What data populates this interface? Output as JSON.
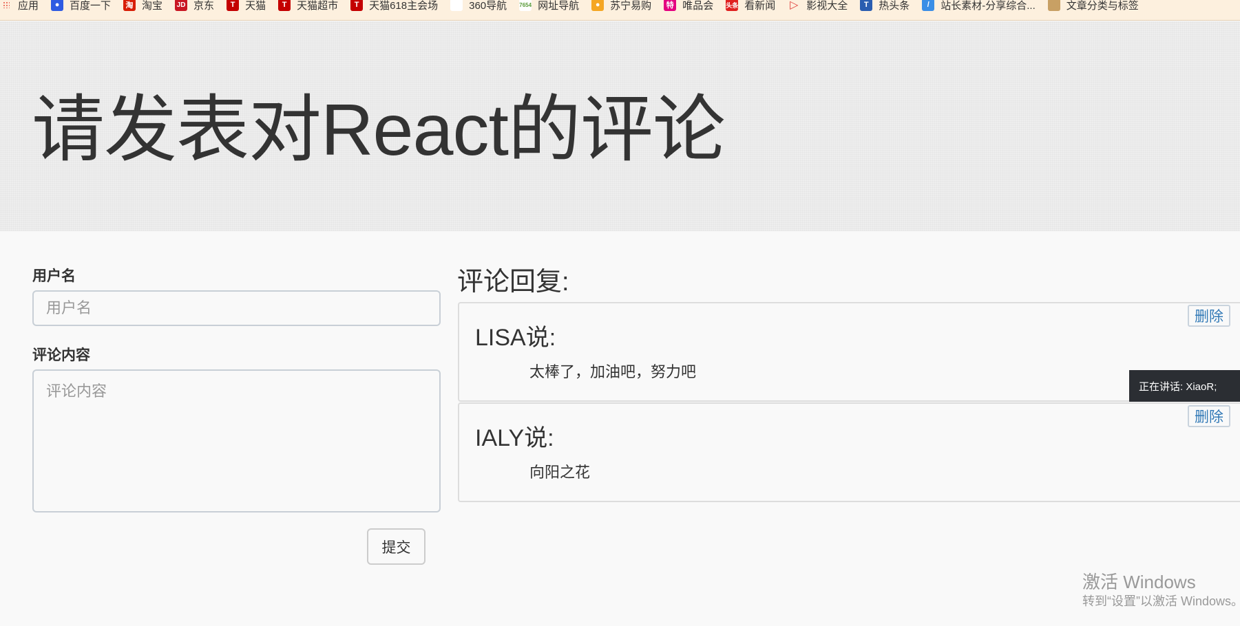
{
  "bookmarks": [
    {
      "label": "应用",
      "icon": "apps-grid-icon",
      "color": "#e74c3c"
    },
    {
      "label": "百度一下",
      "icon": "baidu-paw-icon",
      "color": "#2f5be2"
    },
    {
      "label": "淘宝",
      "icon": "taobao-icon",
      "color": "#d81e06"
    },
    {
      "label": "京东",
      "icon": "jd-icon",
      "color": "#c91623"
    },
    {
      "label": "天猫",
      "icon": "tmall-icon",
      "color": "#c40000"
    },
    {
      "label": "天猫超市",
      "icon": "tmall-market-icon",
      "color": "#c40000"
    },
    {
      "label": "天猫618主会场",
      "icon": "tmall-618-icon",
      "color": "#c40000"
    },
    {
      "label": "360导航",
      "icon": "blank-page-icon",
      "color": "#ffffff"
    },
    {
      "label": "网址导航",
      "icon": "7654-icon",
      "color": "#ffffff"
    },
    {
      "label": "苏宁易购",
      "icon": "suning-icon",
      "color": "#f5a623"
    },
    {
      "label": "唯品会",
      "icon": "vip-icon",
      "color": "#e4007f"
    },
    {
      "label": "看新闻",
      "icon": "toutiao-news-icon",
      "color": "#e02020"
    },
    {
      "label": "影视大全",
      "icon": "play-icon",
      "color": "#e0443f"
    },
    {
      "label": "热头条",
      "icon": "t-headline-icon",
      "color": "#2a5db0"
    },
    {
      "label": "站长素材-分享综合...",
      "icon": "sc-icon",
      "color": "#3a8ee6"
    },
    {
      "label": "文章分类与标签",
      "icon": "folder-icon",
      "color": "#c8a064"
    }
  ],
  "header": {
    "title": "请发表对React的评论"
  },
  "form": {
    "username_label": "用户名",
    "username_placeholder": "用户名",
    "content_label": "评论内容",
    "content_placeholder": "评论内容",
    "submit_label": "提交"
  },
  "comments": {
    "section_title": "评论回复:",
    "items": [
      {
        "author": "LISA说:",
        "body": "太棒了，加油吧，努力吧",
        "delete_label": "删除"
      },
      {
        "author": "IALY说:",
        "body": "向阳之花",
        "delete_label": "删除"
      }
    ]
  },
  "toast": {
    "text": "正在讲话: XiaoR;"
  },
  "watermark": {
    "title": "激活 Windows",
    "subtitle": "转到“设置”以激活 Windows。"
  }
}
